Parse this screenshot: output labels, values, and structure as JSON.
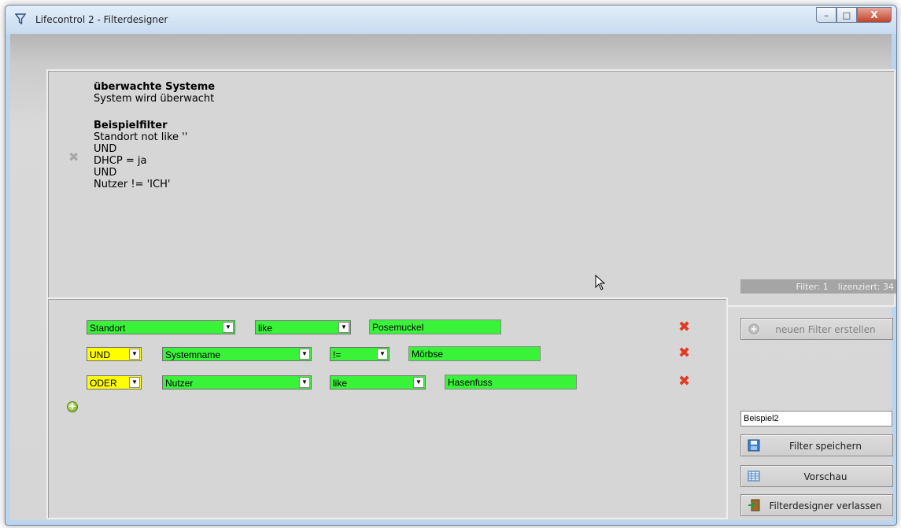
{
  "window": {
    "title": "Lifecontrol 2 - Filterdesigner",
    "icon": "funnel-icon",
    "controls": {
      "minimize": "–",
      "maximize": "□",
      "close": "X"
    }
  },
  "preview": {
    "monitored_heading": "überwachte Systeme",
    "monitored_text": "System wird überwacht",
    "filter_name": "Beispielfilter",
    "filter_lines": [
      "Standort not like ''",
      "UND",
      "DHCP = ja",
      "UND",
      "Nutzer != 'ICH'"
    ]
  },
  "status": {
    "filter_count": "Filter: 1",
    "licensed": "lizenziert: 34"
  },
  "conditions": [
    {
      "connector": "",
      "field": "Standort",
      "operator": "like",
      "value": "Posemuckel"
    },
    {
      "connector": "UND",
      "field": "Systemname",
      "operator": "!=",
      "value": "Mörbse"
    },
    {
      "connector": "ODER",
      "field": "Nutzer",
      "operator": "like",
      "value": "Hasenfuss"
    }
  ],
  "buttons": {
    "new_filter": "neuen Filter erstellen",
    "save": "Filter speichern",
    "preview": "Vorschau",
    "exit": "Filterdesigner verlassen"
  },
  "filter_name_input": {
    "value": "Beispiel2"
  },
  "colors": {
    "field_green": "#39f339",
    "connector_yellow": "#ffff00",
    "delete_red": "#e23a20",
    "panel_grey": "#d6d6d6"
  }
}
